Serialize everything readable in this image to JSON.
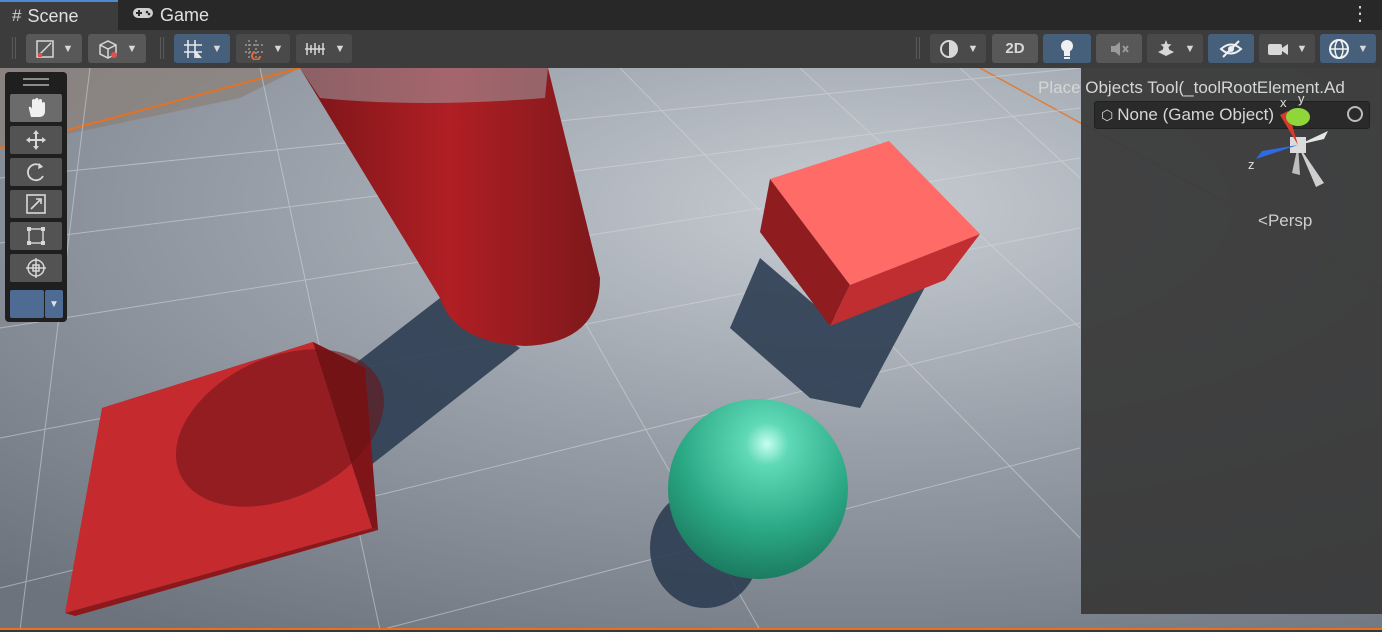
{
  "tabs": [
    {
      "label": "Scene",
      "icon": "grid-hash-icon",
      "active": true
    },
    {
      "label": "Game",
      "icon": "gamepad-icon",
      "active": false
    }
  ],
  "toolbar": {
    "left_buttons": [
      "draw-mode-icon",
      "shading-cube-icon",
      "grid-snap-icon",
      "increment-snap-icon",
      "ruler-icon"
    ],
    "right_buttons": {
      "render_sphere": "render-sphere-icon",
      "twod_label": "2D",
      "lighting": "lightbulb-icon",
      "audio": "audio-mute-icon",
      "effects": "effects-icon",
      "visibility": "hidden-eye-icon",
      "camera": "camera-icon",
      "gizmos": "gizmo-globe-icon"
    }
  },
  "tools": [
    "hand-icon",
    "move-icon",
    "rotate-icon",
    "scale-icon",
    "rect-tool-icon",
    "transform-icon"
  ],
  "overlay": {
    "title": "Place Objects Tool(_toolRootElement.Ad",
    "object_field": "None (Game Object)",
    "projection_label": "Persp",
    "axes": {
      "x": "x",
      "y": "y",
      "z": "z"
    }
  },
  "colors": {
    "accent": "#e8711f",
    "active_button": "#46607c",
    "red_objects": "#c2262a",
    "sphere": "#2aa884"
  }
}
